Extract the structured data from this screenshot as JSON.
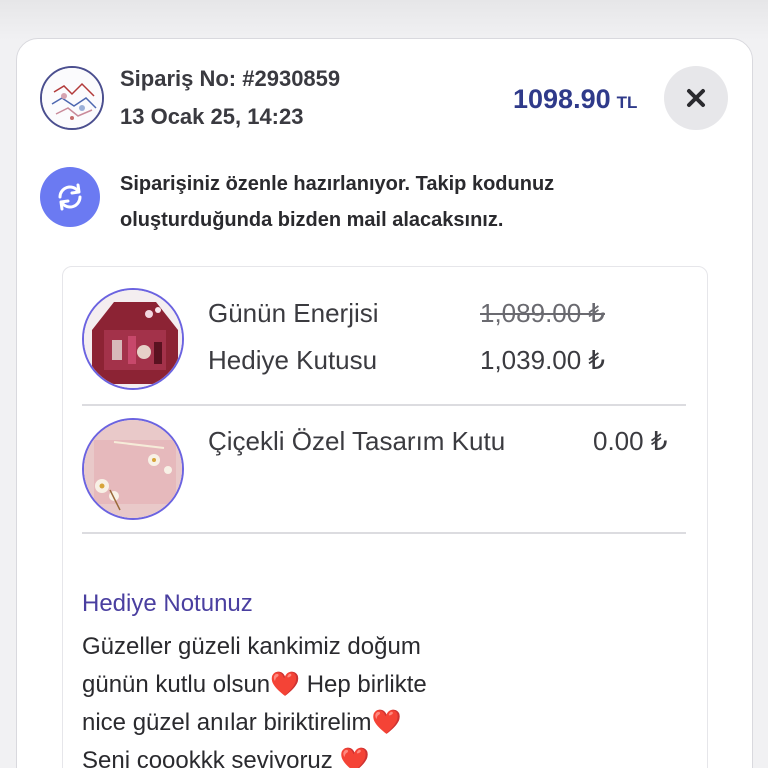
{
  "order": {
    "number": "Sipariş No: #2930859",
    "date": "13 Ocak 25, 14:23",
    "total_value": "1098.90",
    "total_currency": "TL"
  },
  "status": {
    "message": "Siparişiniz özenle hazırlanıyor. Takip kodunuz oluşturduğunda bizden mail alacaksınız."
  },
  "items": [
    {
      "name_line1": "Günün Enerjisi",
      "name_line2": "Hediye Kutusu",
      "old_price": "1,089.00 ₺",
      "price": "1,039.00 ₺"
    },
    {
      "name": "Çiçekli Özel Tasarım Kutu",
      "price": "0.00 ₺"
    }
  ],
  "gift_note": {
    "title": "Hediye Notunuz",
    "line1": "Güzeller güzeli kankimiz doğum",
    "line2a": "günün kutlu olsun",
    "line2b": " Hep birlikte",
    "line3": "nice güzel anılar biriktirelim",
    "line4": "Seni coookkk seviyoruz ",
    "heart": "❤️"
  },
  "colors": {
    "accent": "#2f3a8a",
    "status_icon": "#6b7af2",
    "thumb_border": "#6b63e0",
    "note_title": "#4a3fa0"
  },
  "icons": {
    "close": "close-icon",
    "refresh": "refresh-icon"
  }
}
